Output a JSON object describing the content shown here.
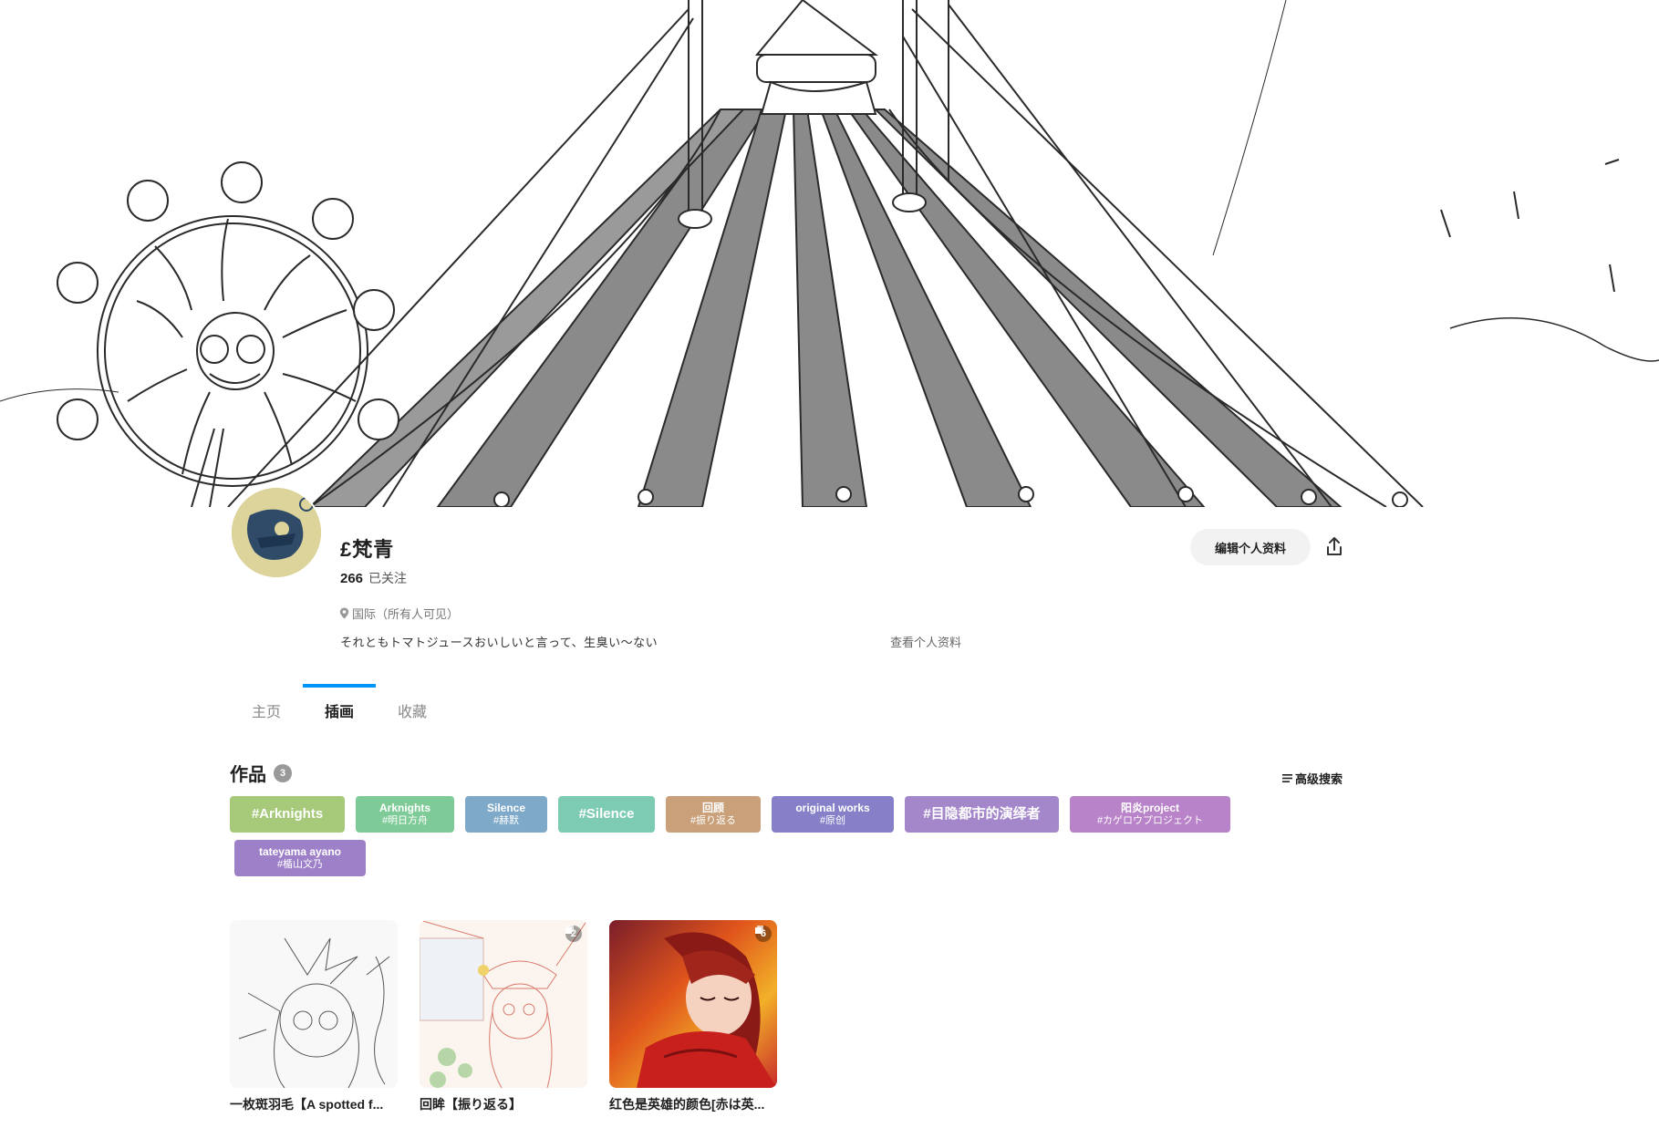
{
  "profile": {
    "username": "£梵青",
    "following_count": "266",
    "following_label": "已关注",
    "location": "国际（所有人可见）",
    "bio": "それともトマトジュースおいしいと言って、生臭い～ない",
    "view_profile_label": "查看个人资料",
    "edit_button_label": "编辑个人资料"
  },
  "tabs": [
    {
      "label": "主页",
      "active": false
    },
    {
      "label": "插画",
      "active": true
    },
    {
      "label": "收藏",
      "active": false
    }
  ],
  "works": {
    "title": "作品",
    "count": "3",
    "advanced_search_label": "高级搜索"
  },
  "tags": [
    {
      "line1": "#Arknights",
      "line2": "",
      "color": "#a6c97a"
    },
    {
      "line1": "Arknights",
      "line2": "#明日方舟",
      "color": "#7fcb98"
    },
    {
      "line1": "Silence",
      "line2": "#赫默",
      "color": "#7ea9c9"
    },
    {
      "line1": "#Silence",
      "line2": "",
      "color": "#7ecbb4"
    },
    {
      "line1": "回顾",
      "line2": "#振り返る",
      "color": "#c9a07a"
    },
    {
      "line1": "original works",
      "line2": "#原创",
      "color": "#8680c9"
    },
    {
      "line1": "#目隐都市的演绎者",
      "line2": "",
      "color": "#a487cb"
    },
    {
      "line1": "阳炎project",
      "line2": "#カゲロウプロジェクト",
      "color": "#b883c9"
    },
    {
      "line1": "tateyama ayano",
      "line2": "#楯山文乃",
      "color": "#9e80c9"
    }
  ],
  "artworks": [
    {
      "title": "一枚斑羽毛【A spotted f...",
      "pages": ""
    },
    {
      "title": "回眸【振り返る】",
      "pages": "2"
    },
    {
      "title": "红色是英雄的颜色[赤は英...",
      "pages": "6"
    }
  ],
  "icons": {
    "location": "map-pin-icon",
    "share": "share-icon",
    "advanced_search": "filter-lines-icon",
    "multi_page": "pages-icon"
  }
}
